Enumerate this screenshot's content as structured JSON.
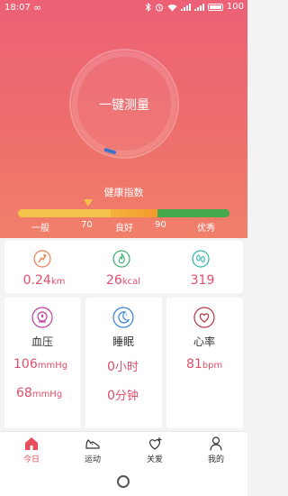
{
  "status_bar": {
    "time": "18:07",
    "infinity": "∞",
    "battery_level": "100"
  },
  "hero": {
    "measure_label": "一键测量",
    "health_index_title": "健康指数",
    "progress": 0.1,
    "scale_labels": [
      "一般",
      "70",
      "良好",
      "90",
      "优秀"
    ],
    "colors": {
      "low": "#f3c24a",
      "mid": "#f39a2b",
      "high": "#43a94a",
      "ring_progress": "#3a73c7"
    }
  },
  "stats": [
    {
      "icon": "distance-icon",
      "value": "0.24",
      "unit": "km"
    },
    {
      "icon": "calorie-flame-icon",
      "value": "26",
      "unit": "kcal"
    },
    {
      "icon": "footprints-icon",
      "value": "319",
      "unit": ""
    }
  ],
  "columns": {
    "blood_pressure": {
      "icon": "blood-pressure-icon",
      "title": "血压",
      "systolic": "106",
      "diastolic": "68",
      "unit": "mmHg"
    },
    "sleep": {
      "icon": "moon-sleep-icon",
      "title": "睡眠",
      "hours": "0",
      "hours_unit": "小时",
      "minutes": "0",
      "minutes_unit": "分钟"
    },
    "heart_rate": {
      "icon": "heart-icon",
      "title": "心率",
      "value": "81",
      "unit": "bpm"
    }
  },
  "nav": [
    {
      "icon": "home-icon",
      "label": "今日",
      "active": true
    },
    {
      "icon": "shoe-icon",
      "label": "运动",
      "active": false
    },
    {
      "icon": "heart-plus-icon",
      "label": "关爱",
      "active": false
    },
    {
      "icon": "person-icon",
      "label": "我的",
      "active": false
    }
  ]
}
